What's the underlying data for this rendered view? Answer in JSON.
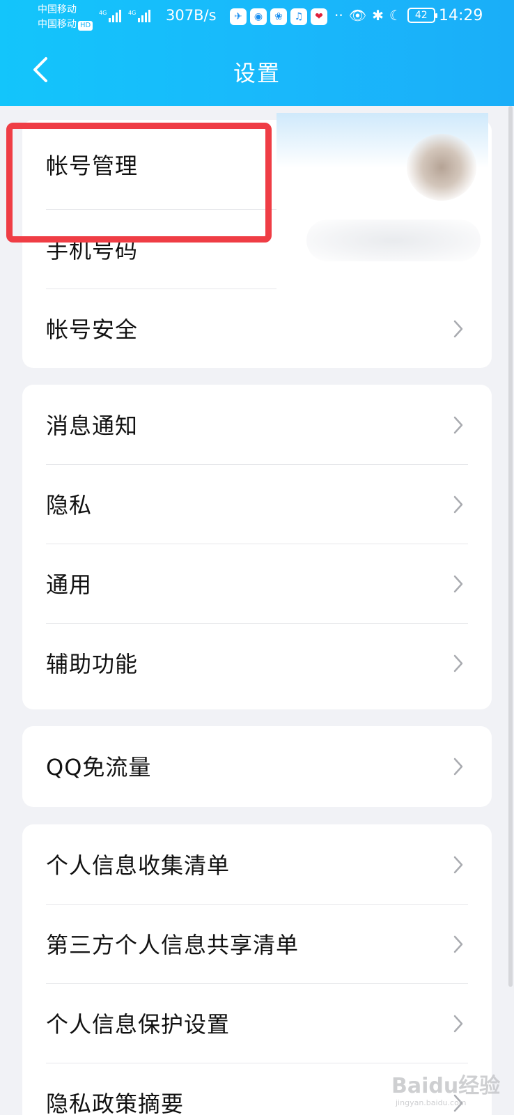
{
  "status_bar": {
    "carrier_1": "中国移动",
    "carrier_2": "中国移动",
    "hd_badge": "HD",
    "network_1": "4G",
    "network_2": "4G",
    "speed": "307B/s",
    "dots": "··",
    "battery": "42",
    "time": "14:29"
  },
  "nav": {
    "title": "设置"
  },
  "sections": {
    "account": [
      "帐号管理",
      "手机号码",
      "帐号安全"
    ],
    "general": [
      "消息通知",
      "隐私",
      "通用",
      "辅助功能"
    ],
    "data": [
      "QQ免流量"
    ],
    "privacy": [
      "个人信息收集清单",
      "第三方个人信息共享清单",
      "个人信息保护设置",
      "隐私政策摘要"
    ]
  },
  "colors": {
    "header_gradient": [
      "#13c5fb",
      "#1aaef8"
    ],
    "highlight": "#ef3d45",
    "card_bg": "#ffffff",
    "page_bg": "#f1f2f6"
  },
  "watermark": {
    "text": "Baidu经验",
    "sub": "jingyan.baidu.com"
  }
}
